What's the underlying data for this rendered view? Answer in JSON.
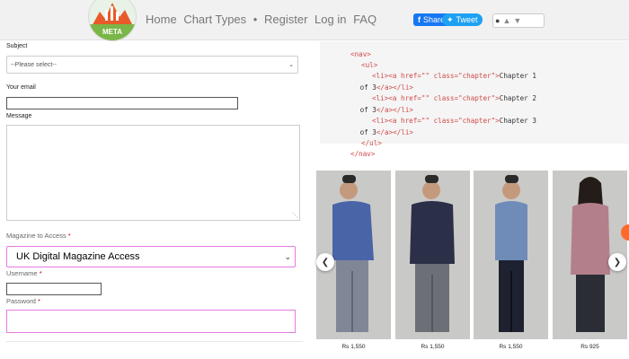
{
  "header": {
    "logo_text": "META",
    "nav": [
      "Home",
      "Chart Types",
      "•",
      "Register",
      "Log in",
      "FAQ"
    ],
    "share_label": "Share",
    "tweet_label": "Tweet"
  },
  "form": {
    "subject_label": "Subject",
    "subject_select_value": "--Please select--",
    "email_label": "Your email",
    "message_label": "Message",
    "magazine_label": "Magazine to Access",
    "magazine_required": "*",
    "magazine_value": "UK Digital Magazine Access",
    "username_label": "Username",
    "username_required": "*",
    "password_label": "Password",
    "password_required": "*"
  },
  "code": {
    "lines": [
      [
        "    ",
        "<nav>"
      ],
      [
        "      ",
        "<ul>"
      ],
      [
        "        ",
        "<li>",
        "<a href=\"\" class=\"chapter\">",
        "Chapter 1"
      ],
      [
        " of 3",
        "</a></li>"
      ],
      [
        "        ",
        "<li>",
        "<a href=\"\" class=\"chapter\">",
        "Chapter 2"
      ],
      [
        " of 3",
        "</a></li>"
      ],
      [
        "        ",
        "<li>",
        "<a href=\"\" class=\"chapter\">",
        "Chapter 3"
      ],
      [
        " of 3",
        "</a></li>"
      ],
      [
        "      ",
        "</ul>"
      ],
      [
        "    ",
        "</nav>"
      ]
    ]
  },
  "products": [
    {
      "price": "Rs 1,550",
      "shirt_color": "#4a64a8",
      "pants_color": "#7f8797"
    },
    {
      "price": "Rs 1,550",
      "shirt_color": "#2b2f48",
      "pants_color": "#6d6f77"
    },
    {
      "price": "Rs 1,550",
      "shirt_color": "#6f8cb8",
      "pants_color": "#1e2230"
    },
    {
      "price": "Rs 925",
      "shirt_color": "#b37f8a",
      "pants_color": "#2b2d36"
    }
  ],
  "colors": {
    "accent_pink": "#e57be0",
    "facebook": "#1877f2",
    "twitter": "#1da1f2"
  }
}
